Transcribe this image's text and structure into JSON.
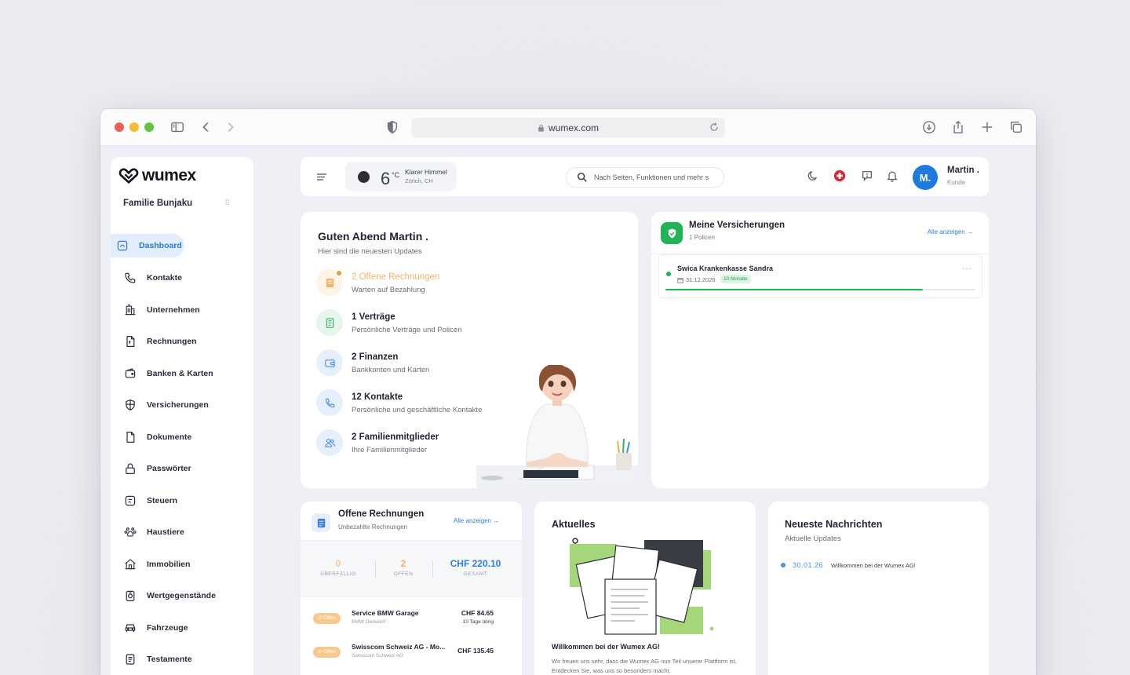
{
  "browser": {
    "url": "wumex.com"
  },
  "app": {
    "brand": "wumex",
    "family": "Familie Bunjaku"
  },
  "sidebar": {
    "items": [
      {
        "label": "Dashboard",
        "icon": "dashboard-icon",
        "active": true
      },
      {
        "label": "Kontakte",
        "icon": "phone-icon"
      },
      {
        "label": "Unternehmen",
        "icon": "building-icon"
      },
      {
        "label": "Rechnungen",
        "icon": "invoice-icon"
      },
      {
        "label": "Banken & Karten",
        "icon": "wallet-icon"
      },
      {
        "label": "Versicherungen",
        "icon": "shield-icon"
      },
      {
        "label": "Dokumente",
        "icon": "document-icon"
      },
      {
        "label": "Passwörter",
        "icon": "lock-icon"
      },
      {
        "label": "Steuern",
        "icon": "tax-icon"
      },
      {
        "label": "Haustiere",
        "icon": "paw-icon"
      },
      {
        "label": "Immobilien",
        "icon": "house-icon"
      },
      {
        "label": "Wertgegenstände",
        "icon": "valuables-icon"
      },
      {
        "label": "Fahrzeuge",
        "icon": "car-icon"
      },
      {
        "label": "Testamente",
        "icon": "will-icon"
      }
    ]
  },
  "header": {
    "weather": {
      "temp": "6",
      "unit": "°C",
      "desc": "Klarer Himmel",
      "location": "Zürich, CH"
    },
    "search_placeholder": "Nach Seiten, Funktionen und mehr s",
    "user": {
      "initial": "M.",
      "name": "Martin .",
      "role": "Kunde"
    }
  },
  "welcome": {
    "title": "Guten Abend Martin .",
    "subtitle": "Hier sind die neuesten Updates",
    "updates": [
      {
        "title": "2 Offene Rechnungen",
        "subtitle": "Warten auf Bezahlung",
        "icon": "invoice-icon",
        "color": "#f2b46a",
        "bg": "#fdf3e6"
      },
      {
        "title": "1 Verträge",
        "subtitle": "Persönliche Verträge und Policen",
        "icon": "contract-icon",
        "color": "#3fae6a",
        "bg": "#e6f6ec"
      },
      {
        "title": "2 Finanzen",
        "subtitle": "Bankkonten und Karten",
        "icon": "wallet-icon",
        "color": "#4a8ee8",
        "bg": "#e6effc"
      },
      {
        "title": "12 Kontakte",
        "subtitle": "Persönliche und geschäftliche Kontakte",
        "icon": "phone-icon",
        "color": "#4a8ee8",
        "bg": "#e6effc"
      },
      {
        "title": "2 Familienmitglieder",
        "subtitle": "Ihre Familienmitglieder",
        "icon": "users-icon",
        "color": "#4a8ee8",
        "bg": "#e6effc"
      }
    ]
  },
  "insurance": {
    "title": "Meine Versicherungen",
    "subtitle": "1 Policen",
    "link": "Alle anzeigen",
    "policy": {
      "name": "Swica Krankenkasse Sandra",
      "date": "31.12.2026",
      "badge": "10 Monate",
      "progress": 0.83
    }
  },
  "invoices": {
    "title": "Offene Rechnungen",
    "subtitle": "Unbezahlte Rechnungen",
    "link": "Alle anzeigen",
    "stats": [
      {
        "value": "0",
        "label": "ÜBERFÄLLIG",
        "color": "#f7c98c"
      },
      {
        "value": "2",
        "label": "OFFEN",
        "color": "#f2b46a"
      },
      {
        "value": "CHF 220.10",
        "label": "GESAMT",
        "color": "#2b7fe0"
      }
    ],
    "rows": [
      {
        "status": "Offen",
        "name": "Service BMW Garage",
        "company": "BMW Dielsdorf",
        "amount": "CHF 84.65",
        "due": "10 Tage übrig"
      },
      {
        "status": "Offen",
        "name": "Swisscom Schweiz AG - Mo...",
        "company": "Swisscom Schweiz AG",
        "amount": "CHF 135.45",
        "due": ""
      }
    ]
  },
  "news": {
    "title": "Aktuelles",
    "headline": "Willkommen bei der Wumex AG!",
    "body": "Wir freuen uns sehr, dass die Wumex AG nun Teil unserer Plattform ist. Entdecken Sie, was uns so besonders macht."
  },
  "messages": {
    "title": "Neueste Nachrichten",
    "subtitle": "Aktuelle Updates",
    "items": [
      {
        "date": "30.01.26",
        "text": "Willkommen bei der Wumex AG!"
      }
    ]
  }
}
